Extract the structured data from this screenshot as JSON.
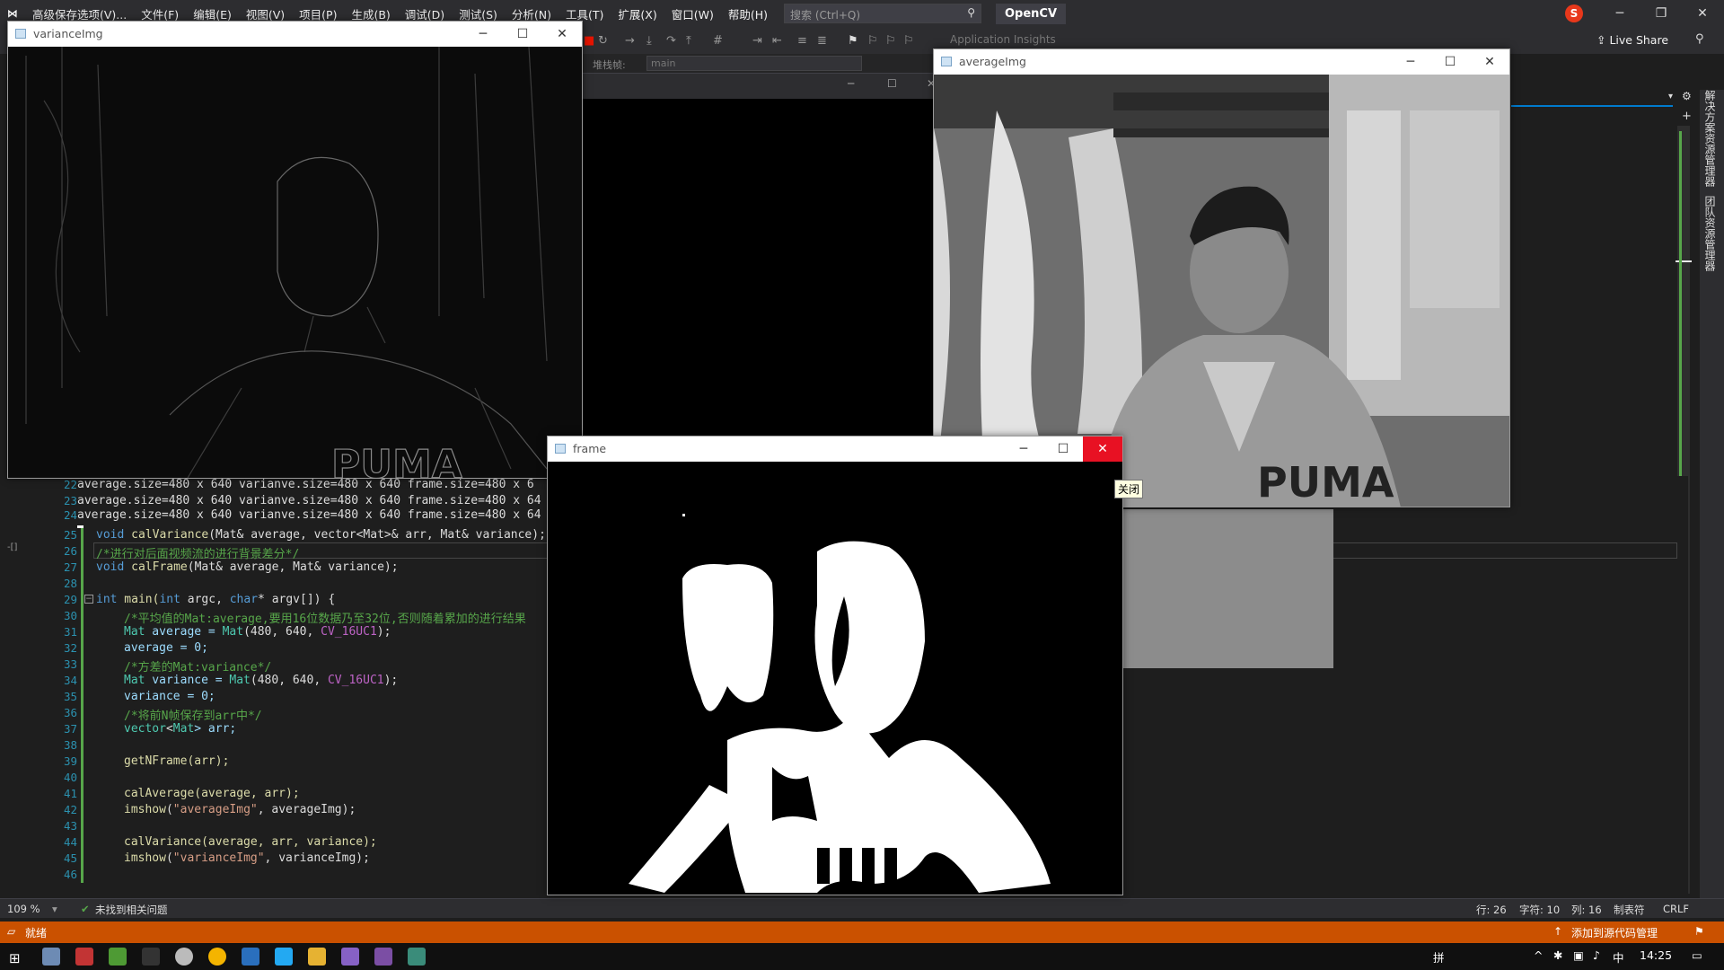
{
  "vs": {
    "title": "高级保存选项(V)...",
    "menus": [
      "文件(F)",
      "编辑(E)",
      "视图(V)",
      "项目(P)",
      "生成(B)",
      "调试(D)",
      "测试(S)",
      "分析(N)",
      "工具(T)",
      "扩展(X)",
      "窗口(W)",
      "帮助(H)"
    ],
    "search_placeholder": "搜索 (Ctrl+Q)",
    "project": "OpenCV",
    "user_initial": "S",
    "app_insights": "Application Insights",
    "live_share": "Live Share",
    "stack_label": "堆栈帧:",
    "stack_value": "main"
  },
  "vertical_tabs": [
    "解决方案资源管理器",
    "团队资源管理器"
  ],
  "output_lines": [
    {
      "num": "22",
      "text": "average.size=480 x 640 varianve.size=480 x 640 frame.size=480 x 6"
    },
    {
      "num": "23",
      "text": "average.size=480 x 640 varianve.size=480 x 640 frame.size=480 x 64"
    },
    {
      "num": "24",
      "text": "average.size=480 x 640 varianve.size=480 x 640 frame.size=480 x 64"
    }
  ],
  "code": {
    "l25": {
      "num": "25",
      "kw": "void",
      "fn": "calVariance",
      "rest": "(Mat& average, vector<Mat>& arr, Mat& variance);"
    },
    "l26": {
      "num": "26",
      "text": "/*进行对后面视频流的进行背景差分*/"
    },
    "l27": {
      "num": "27",
      "kw": "void",
      "fn": "calFrame",
      "rest": "(Mat& average, Mat& variance);"
    },
    "l28": {
      "num": "28"
    },
    "l29": {
      "num": "29",
      "a": "int",
      "b": " main(",
      "c": "int",
      "d": " argc, ",
      "e": "char",
      "f": "* argv[]) {"
    },
    "l30": {
      "num": "30",
      "text": "/*平均值的Mat:average,要用16位数据乃至32位,否则随着累加的进行结果"
    },
    "l31": {
      "num": "31",
      "a": "Mat",
      "b": " average = ",
      "c": "Mat",
      "d": "(480, 640, ",
      "e": "CV_16UC1",
      "f": ");"
    },
    "l32": {
      "num": "32",
      "text": "average = 0;"
    },
    "l33": {
      "num": "33",
      "text": "/*方差的Mat:variance*/"
    },
    "l34": {
      "num": "34",
      "a": "Mat",
      "b": " variance = ",
      "c": "Mat",
      "d": "(480, 640, ",
      "e": "CV_16UC1",
      "f": ");"
    },
    "l35": {
      "num": "35",
      "text": "variance = 0;"
    },
    "l36": {
      "num": "36",
      "text": "/*将前N帧保存到arr中*/"
    },
    "l37": {
      "num": "37",
      "a": "vector",
      "b": "<",
      "c": "Mat",
      "d": "> arr;"
    },
    "l38": {
      "num": "38"
    },
    "l39": {
      "num": "39",
      "text": "getNFrame(arr);"
    },
    "l40": {
      "num": "40"
    },
    "l41": {
      "num": "41",
      "text": "calAverage(average, arr);"
    },
    "l42": {
      "num": "42",
      "fn": "imshow",
      "s": "\"averageImg\"",
      "rest": ", averageImg);"
    },
    "l43": {
      "num": "43"
    },
    "l44": {
      "num": "44",
      "text": "calVariance(average, arr, variance);"
    },
    "l45": {
      "num": "45",
      "fn": "imshow",
      "s": "\"varianceImg\"",
      "rest": ", varianceImg);"
    },
    "l46": {
      "num": "46"
    }
  },
  "editor_status": {
    "zoom": "109 %",
    "issues": "未找到相关问题",
    "line": "行: 26",
    "char": "字符: 10",
    "col": "列: 16",
    "tabs": "制表符",
    "eol": "CRLF"
  },
  "status": {
    "ready": "就绪",
    "source_control": "添加到源代码管理"
  },
  "taskbar": {
    "ime": "拼",
    "time": "14:25"
  },
  "windows": {
    "variance": "varianceImg",
    "average": "averageImg",
    "frame": "frame"
  },
  "tooltip": "关闭"
}
